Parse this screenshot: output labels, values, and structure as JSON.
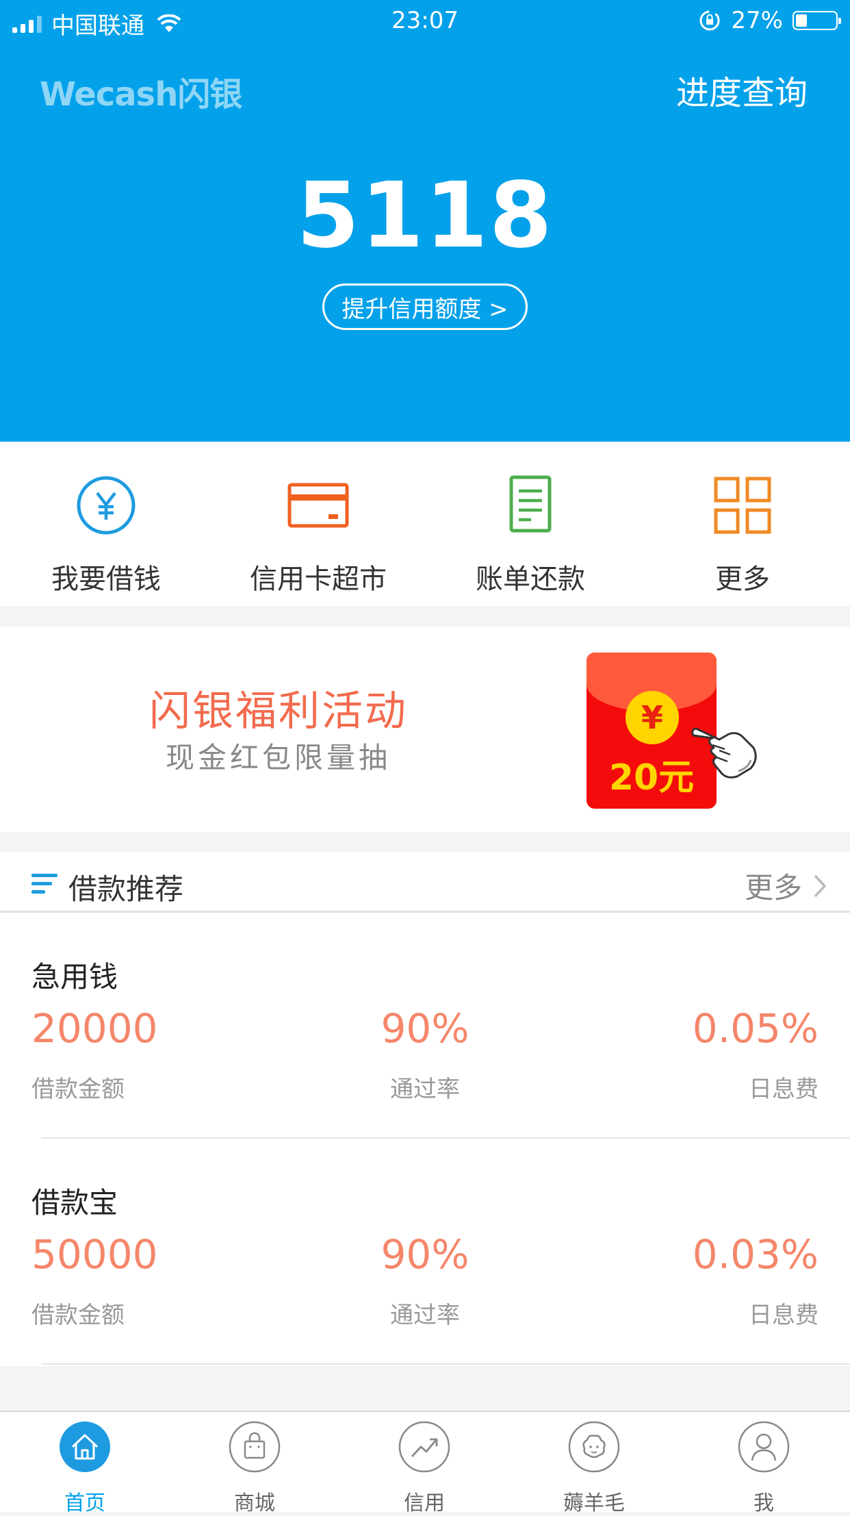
{
  "status_bar": {
    "carrier": "中国联通",
    "time": "23:07",
    "battery": "27%"
  },
  "header": {
    "logo": "Wecash闪银",
    "progress_link": "进度查询",
    "credit_amount": "5118",
    "raise_button": "提升信用额度 >"
  },
  "quick_actions": [
    {
      "label": "我要借钱",
      "icon": "yuan-circle-icon",
      "color": "#1e9be0"
    },
    {
      "label": "信用卡超市",
      "icon": "credit-card-icon",
      "color": "#f06020"
    },
    {
      "label": "账单还款",
      "icon": "bill-icon",
      "color": "#4cae4c"
    },
    {
      "label": "更多",
      "icon": "grid-icon",
      "color": "#f08a24"
    }
  ],
  "promo": {
    "title": "闪银福利活动",
    "subtitle": "现金红包限量抽",
    "packet_symbol": "¥",
    "packet_amount": "20元"
  },
  "recommend": {
    "title": "借款推荐",
    "more": "更多",
    "items": [
      {
        "name": "急用钱",
        "amount": "20000",
        "amount_label": "借款金额",
        "pass_rate": "90%",
        "pass_rate_label": "通过率",
        "daily_fee": "0.05%",
        "daily_fee_label": "日息费"
      },
      {
        "name": "借款宝",
        "amount": "50000",
        "amount_label": "借款金额",
        "pass_rate": "90%",
        "pass_rate_label": "通过率",
        "daily_fee": "0.03%",
        "daily_fee_label": "日息费"
      }
    ]
  },
  "tabbar": [
    {
      "label": "首页",
      "icon": "home-icon",
      "active": true
    },
    {
      "label": "商城",
      "icon": "shopping-bag-icon",
      "active": false
    },
    {
      "label": "信用",
      "icon": "trend-icon",
      "active": false
    },
    {
      "label": "薅羊毛",
      "icon": "sheep-icon",
      "active": false
    },
    {
      "label": "我",
      "icon": "user-icon",
      "active": false
    }
  ],
  "colors": {
    "brand": "#03a1ea",
    "value": "#f5866a",
    "promo_title": "#f26b4e"
  }
}
